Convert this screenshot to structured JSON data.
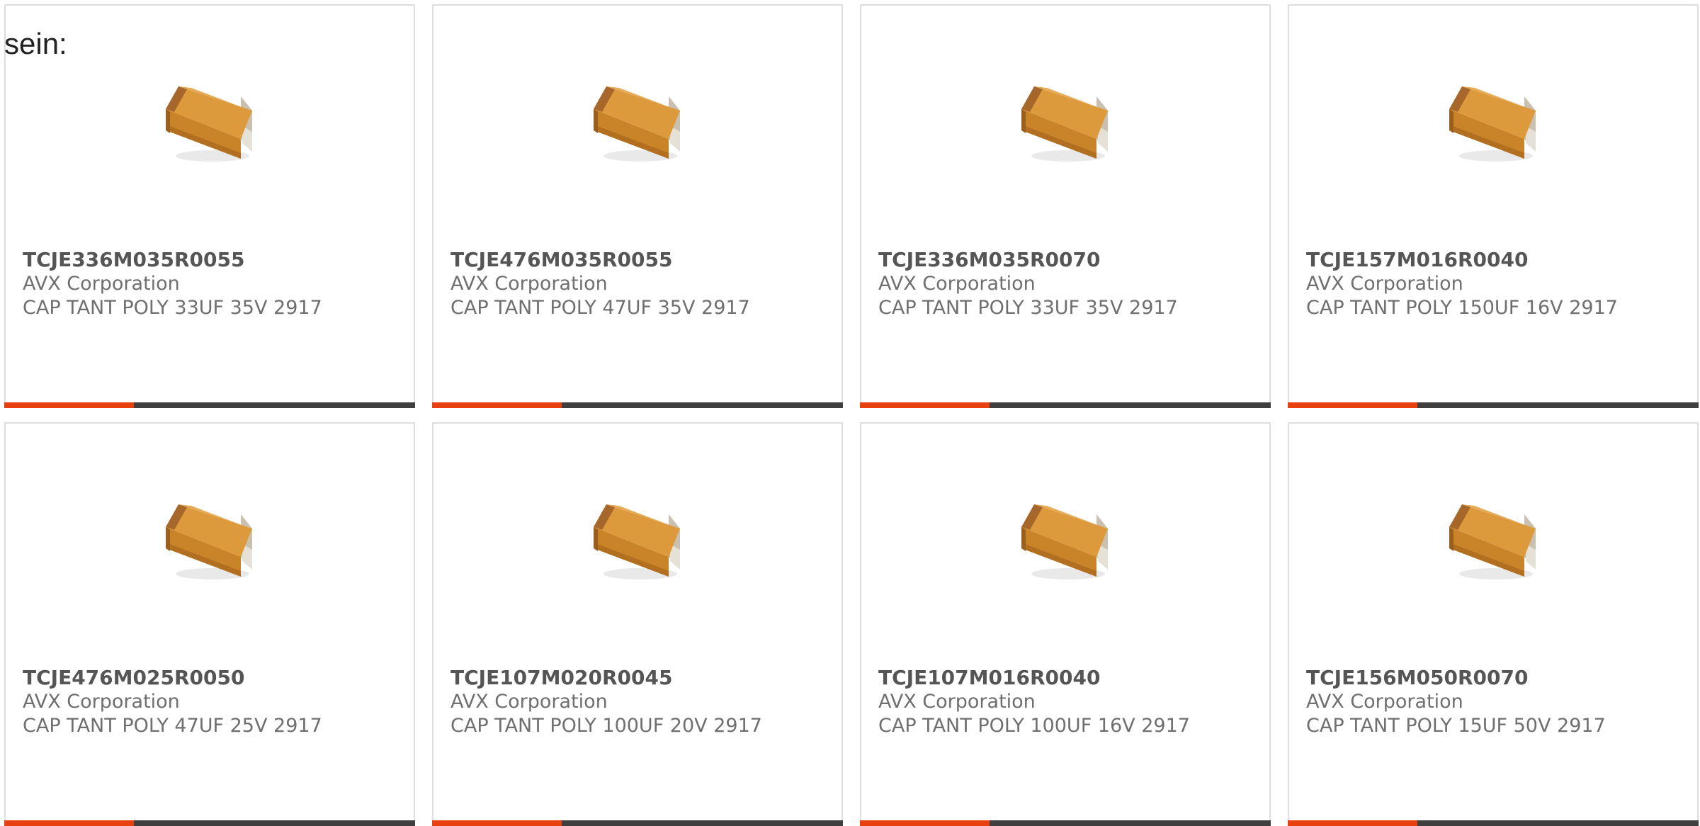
{
  "intro_text": "sein:",
  "colors": {
    "accent": "#e8400e",
    "bar": "#3f3f3f",
    "border": "#dedede",
    "part_number": "#555555",
    "secondary_text": "#6f6f6f",
    "component_body": "#d08a2c"
  },
  "products": [
    {
      "part_number": "TCJE336M035R0055",
      "manufacturer": "AVX Corporation",
      "description": "CAP TANT POLY 33UF 35V 2917",
      "image_icon": "tantalum-capacitor-icon"
    },
    {
      "part_number": "TCJE476M035R0055",
      "manufacturer": "AVX Corporation",
      "description": "CAP TANT POLY 47UF 35V 2917",
      "image_icon": "tantalum-capacitor-icon"
    },
    {
      "part_number": "TCJE336M035R0070",
      "manufacturer": "AVX Corporation",
      "description": "CAP TANT POLY 33UF 35V 2917",
      "image_icon": "tantalum-capacitor-icon"
    },
    {
      "part_number": "TCJE157M016R0040",
      "manufacturer": "AVX Corporation",
      "description": "CAP TANT POLY 150UF 16V 2917",
      "image_icon": "tantalum-capacitor-icon"
    },
    {
      "part_number": "TCJE476M025R0050",
      "manufacturer": "AVX Corporation",
      "description": "CAP TANT POLY 47UF 25V 2917",
      "image_icon": "tantalum-capacitor-icon"
    },
    {
      "part_number": "TCJE107M020R0045",
      "manufacturer": "AVX Corporation",
      "description": "CAP TANT POLY 100UF 20V 2917",
      "image_icon": "tantalum-capacitor-icon"
    },
    {
      "part_number": "TCJE107M016R0040",
      "manufacturer": "AVX Corporation",
      "description": "CAP TANT POLY 100UF 16V 2917",
      "image_icon": "tantalum-capacitor-icon"
    },
    {
      "part_number": "TCJE156M050R0070",
      "manufacturer": "AVX Corporation",
      "description": "CAP TANT POLY 15UF 50V 2917",
      "image_icon": "tantalum-capacitor-icon"
    }
  ]
}
